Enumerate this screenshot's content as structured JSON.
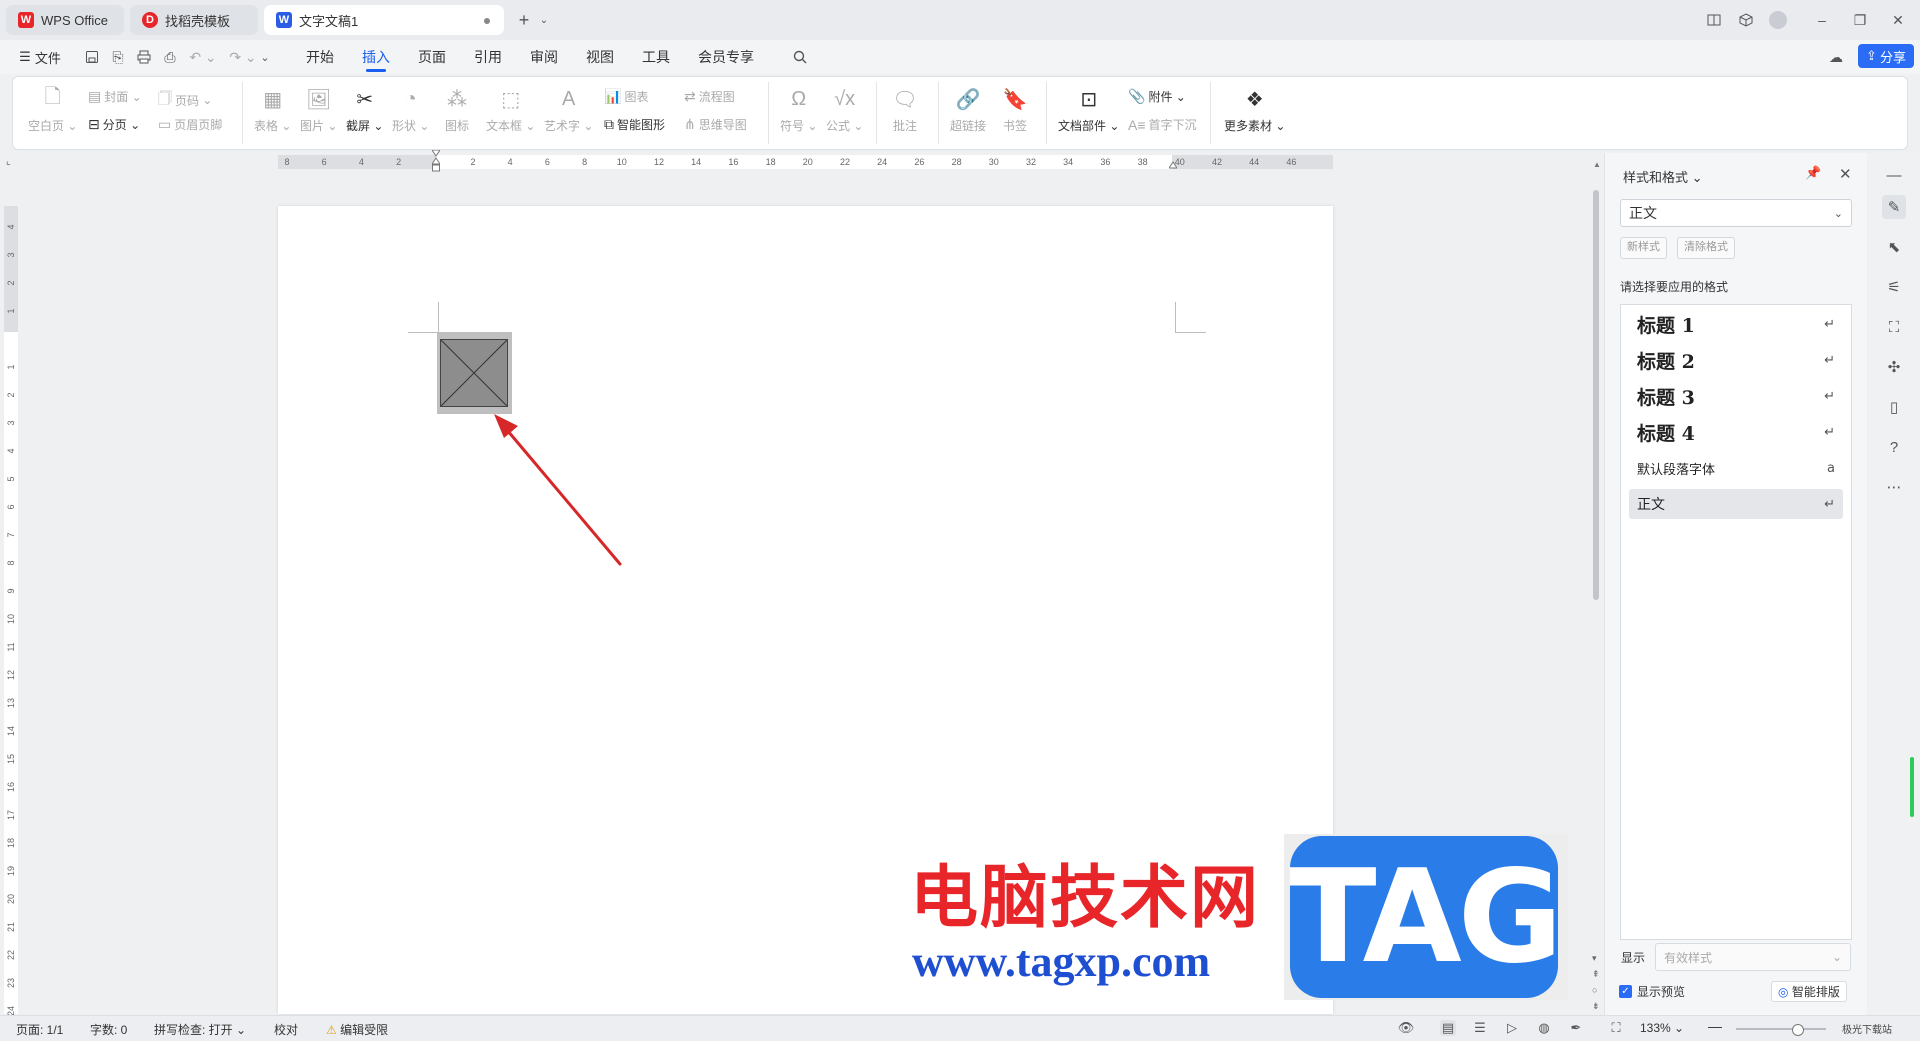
{
  "tabs": [
    {
      "label": "WPS Office",
      "logo": "W",
      "color": "#e8262a"
    },
    {
      "label": "找稻壳模板",
      "logo": "D",
      "color": "#e8262a"
    },
    {
      "label": "文字文稿1",
      "logo": "W",
      "color": "#2b5ce6"
    }
  ],
  "menu": {
    "file": "文件",
    "tabs": [
      "开始",
      "插入",
      "页面",
      "引用",
      "审阅",
      "视图",
      "工具",
      "会员专享"
    ],
    "active_tab": "插入",
    "share": "分享"
  },
  "ribbon": {
    "blank_page": "空白页",
    "cover": "封面",
    "page_break": "分页",
    "page_number": "页码",
    "header_footer": "页眉页脚",
    "table": "表格",
    "picture": "图片",
    "screenshot": "截屏",
    "shape": "形状",
    "icon": "图标",
    "textbox": "文本框",
    "wordart": "艺术字",
    "chart": "图表",
    "smart_graphic": "智能图形",
    "flowchart": "流程图",
    "mindmap": "思维导图",
    "symbol": "符号",
    "formula": "公式",
    "comment": "批注",
    "hyperlink": "超链接",
    "bookmark": "书签",
    "doc_parts": "文档部件",
    "attachment": "附件",
    "drop_cap": "首字下沉",
    "more_materials": "更多素材"
  },
  "ruler": {
    "h_ticks": [
      "8",
      "6",
      "4",
      "2",
      "",
      "2",
      "4",
      "6",
      "8",
      "10",
      "12",
      "14",
      "16",
      "18",
      "20",
      "22",
      "24",
      "26",
      "28",
      "30",
      "32",
      "34",
      "36",
      "38",
      "40",
      "42",
      "44",
      "46"
    ],
    "v_ticks": [
      "4",
      "3",
      "2",
      "1",
      "",
      "1",
      "2",
      "3",
      "4",
      "5",
      "6",
      "7",
      "8",
      "9",
      "10",
      "11",
      "12",
      "13",
      "14",
      "15",
      "16",
      "17",
      "18",
      "19",
      "20",
      "21",
      "22",
      "23",
      "24"
    ]
  },
  "panel": {
    "title": "样式和格式",
    "current_style": "正文",
    "new_style": "新样式",
    "clear_format": "清除格式",
    "prompt": "请选择要应用的格式",
    "styles": [
      {
        "label": "标题  1",
        "mark": "↵",
        "heading": true
      },
      {
        "label": "标题  2",
        "mark": "↵",
        "heading": true
      },
      {
        "label": "标题  3",
        "mark": "↵",
        "heading": true
      },
      {
        "label": "标题  4",
        "mark": "↵",
        "heading": true
      },
      {
        "label": "默认段落字体",
        "mark": "a",
        "heading": false
      },
      {
        "label": "正文",
        "mark": "↵",
        "heading": false,
        "selected": true
      }
    ],
    "display_label": "显示",
    "display_value": "有效样式",
    "show_preview": "显示预览",
    "smart_layout": "智能排版"
  },
  "watermark": {
    "cn": "电脑技术网",
    "url": "www.tagxp.com",
    "tag": "TAG",
    "corner": "极光下载站"
  },
  "status": {
    "page": "页面: 1/1",
    "words": "字数: 0",
    "spellcheck": "拼写检查: 打开",
    "proofread": "校对",
    "edit_restricted": "编辑受限",
    "zoom": "133%"
  },
  "colors": {
    "accent": "#1a5ef0",
    "arrow": "#d62828"
  }
}
